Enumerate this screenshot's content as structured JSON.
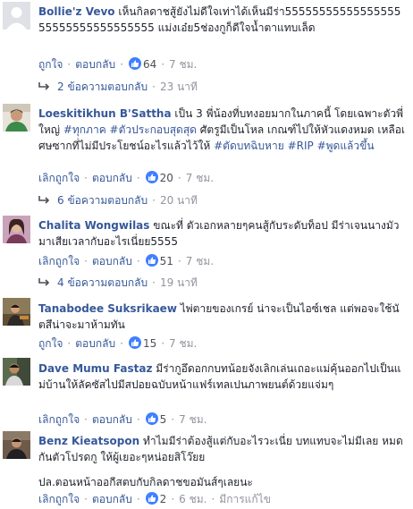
{
  "comments": [
    {
      "author": "Bollie'z Vevo",
      "text": "เห็นกิลดาชสู้ยังไม่ดีใจเท่าได้เห็นมีร่า5555555555555555555555555555555555 แม่งเอ๋ย5ช่องกูก็ดีใจน้ำตาแทบเล็ด",
      "like": "ถูกใจ",
      "reply": "ตอบกลับ",
      "likes": "64",
      "time": "7 ชม.",
      "replies": "2 ข้อความตอบกลับ",
      "replies_time": "23 นาที"
    },
    {
      "author": "Loeskitikhun B'Sattha",
      "text_a": "เป็น 3 พี่น้องที่บทงอยมากในภาคนี้ โดยเฉพาะตัวพี่ใหญ่ ",
      "tag1": "#ทุกภาค",
      "tag2": "#ตัวประกอบสุดสุด",
      "text_b": " ศัตรูมีเป็นโหล เกณฑ์ไปให้หัวแดงหมด เหลือเศษซากที่ไม่มีประโยชน์อะไรแล้วไว้ให้ ",
      "tag3": "#ตัดบทฉิบหาย",
      "tag4": "#RIP",
      "tag5": "#พูดแล้วขึ้น",
      "like": "เลิกถูกใจ",
      "reply": "ตอบกลับ",
      "likes": "20",
      "time": "7 ชม.",
      "replies": "6 ข้อความตอบกลับ",
      "replies_time": "20 นาที"
    },
    {
      "author": "Chalita Wongwilas",
      "text": "ขณะที่ ตัวเอกหลายๆคนสู้กับระดับท็อป มีร่าเจนนางมัวมาเสียเวลากับอะไรเนี่ยย5555",
      "like": "เลิกถูกใจ",
      "reply": "ตอบกลับ",
      "likes": "51",
      "time": "7 ชม.",
      "replies": "4 ข้อความตอบกลับ",
      "replies_time": "19 นาที"
    },
    {
      "author": "Tanabodee Suksrikaew",
      "text": "ไพ่ตายของเกรย์ น่าจะเป็นไอซ์เชล แต่พอจะใช้นัตสึน่าจะมาห้ามทัน",
      "like": "ถูกใจ",
      "reply": "ตอบกลับ",
      "likes": "15",
      "time": "7 ชม."
    },
    {
      "author": "Dave Mumu Fastaz",
      "text": "มีร่ากูอึดอกกบทน้อยจังเลิกเล่นเถอะแม่คุ้นออกไปเป็นแม่บ้านให้ลัคซัสไปมีสปอยฉบับหน้าแฟร์เทลเปนภาพยนต์ด้วยแจ่มๆ",
      "like": "เลิกถูกใจ",
      "reply": "ตอบกลับ",
      "likes": "5",
      "time": "7 ชม."
    },
    {
      "author": "Benz Kieatsopon",
      "text": "ทำไมมีร่าต้องสู้แต่กับอะไรวะเนี่ย บทแทบจะไม่มีเลย หมดกันตัวโปรดกู ให้ผู้เยอะๆหน่อยสิโว๊ยย",
      "text2": "ปล.ตอนหน้าออกีสตบกับกิลดาชขอมันส์ๆเลยนะ",
      "like": "เลิกถูกใจ",
      "reply": "ตอบกลับ",
      "likes": "2",
      "time": "6 ชม.",
      "edited": "มีการแก้ไข"
    }
  ],
  "colors": {
    "name": "#365899",
    "text": "#1d2129",
    "meta": "#90949c",
    "like": "#4080ff"
  },
  "icons": {
    "like": "thumbs-up-icon",
    "reply_arrow": "reply-arrow-icon"
  }
}
